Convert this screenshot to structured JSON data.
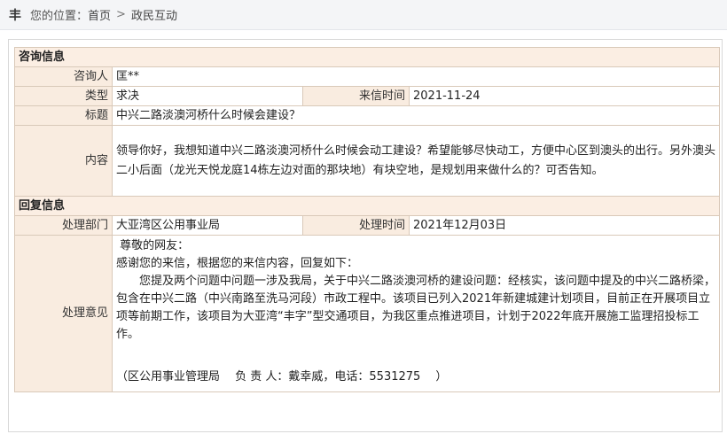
{
  "breadcrumb": {
    "prefix": "您的位置：",
    "home": "首页",
    "separator": ">",
    "current": "政民互动"
  },
  "consult": {
    "section_title": "咨询信息",
    "consultant_label": "咨询人",
    "consultant_value": "匡**",
    "type_label": "类型",
    "type_value": "求决",
    "date_label": "来信时间",
    "date_value": "2021-11-24",
    "title_label": "标题",
    "title_value": "中兴二路淡澳河桥什么时候会建设？",
    "content_label": "内容",
    "content_value": "领导你好，我想知道中兴二路淡澳河桥什么时候会动工建设？希望能够尽快动工，方便中心区到澳头的出行。另外澳头二小后面（龙光天悦龙庭14栋左边对面的那块地）有块空地，是规划用来做什么的？可否告知。"
  },
  "reply": {
    "section_title": "回复信息",
    "dept_label": "处理部门",
    "dept_value": "大亚湾区公用事业局",
    "time_label": "处理时间",
    "time_value": "2021年12月03日",
    "opinion_label": "处理意见",
    "greeting": " 尊敬的网友：",
    "thanks": "感谢您的来信，根据您的来信内容，回复如下：",
    "body": "您提及两个问题中问题一涉及我局，关于中兴二路淡澳河桥的建设问题：经核实，该问题中提及的中兴二路桥梁，包含在中兴二路（中兴南路至洗马河段）市政工程中。该项目已列入2021年新建城建计划项目，目前正在开展项目立项等前期工作，该项目为大亚湾“丰字”型交通项目，为我区重点推进项目，计划于2022年底开展施工监理招投标工作。",
    "signature": "（区公用事业管理局　 负 责 人：戴幸威，电话：5531275　 ）"
  }
}
